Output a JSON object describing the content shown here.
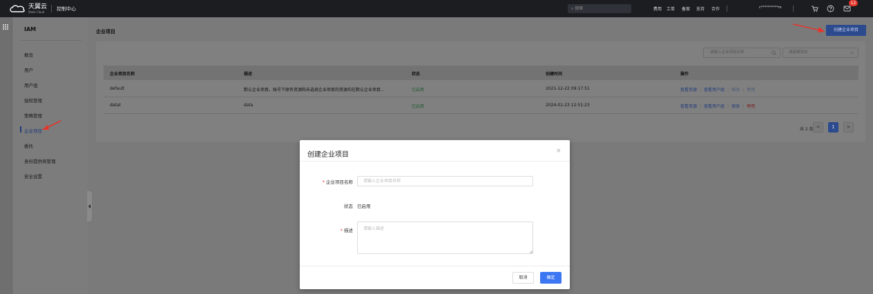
{
  "topbar": {
    "logo_cn": "天翼云",
    "logo_en": "State Cloud",
    "console": "控制中心",
    "search_placeholder": "搜索",
    "nav": [
      "费用",
      "工单",
      "备案",
      "支持",
      "合作"
    ],
    "account": "c**********m",
    "notification_count": "12"
  },
  "sidebar": {
    "title": "IAM",
    "items": [
      {
        "label": "概览"
      },
      {
        "label": "用户"
      },
      {
        "label": "用户组"
      },
      {
        "label": "授权管理"
      },
      {
        "label": "策略管理"
      },
      {
        "label": "企业项目",
        "active": true
      },
      {
        "label": "委托"
      },
      {
        "label": "身份提供商管理"
      },
      {
        "label": "安全设置"
      }
    ]
  },
  "main": {
    "title": "企业项目",
    "create_button": "创建企业项目",
    "filter_placeholder": "请输入企业项目名称",
    "status_placeholder": "请选择状态",
    "table": {
      "headers": [
        "企业项目名称",
        "描述",
        "状态",
        "创建时间",
        "操作"
      ],
      "rows": [
        {
          "name": "default",
          "desc": "默认企业项目，账号下原有资源和未选择企业项目的资源均在默认企业项目...",
          "status": "已启用",
          "created": "2021-12-22 09:17:51",
          "ops": [
            "查看资源",
            "查看用户组",
            "修改",
            "停用"
          ]
        },
        {
          "name": "datat",
          "desc": "data",
          "status": "已启用",
          "created": "2024-01-23 12:51:23",
          "ops": [
            "查看资源",
            "查看用户组",
            "修改",
            "停用"
          ]
        }
      ]
    },
    "pagination": {
      "total": "共 2 条",
      "current": "1",
      "prev": "<",
      "next": ">"
    }
  },
  "dialog": {
    "title": "创建企业项目",
    "close": "×",
    "name_label": "企业项目名称",
    "name_placeholder": "请输入企业项目名称",
    "status_label": "状态",
    "status_value": "已启用",
    "desc_label": "描述",
    "desc_placeholder": "请输入描述",
    "cancel": "取消",
    "ok": "确定"
  },
  "colors": {
    "topbar_bg": "#1b1d21",
    "primary": "#3d76f2",
    "danger": "#e6352b",
    "success": "#2dac5a"
  }
}
